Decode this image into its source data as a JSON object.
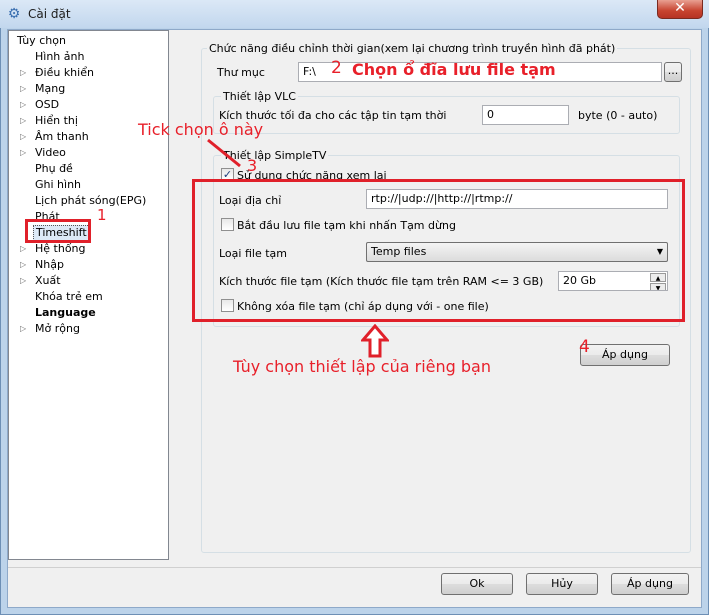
{
  "window": {
    "title": "Cài đặt",
    "close_glyph": "✕",
    "icon": "settings-app-icon"
  },
  "tree": {
    "root": "Tùy chọn",
    "items": [
      {
        "label": "Hình ảnh",
        "expander": false
      },
      {
        "label": "Điều khiển",
        "expander": true
      },
      {
        "label": "Mạng",
        "expander": true
      },
      {
        "label": "OSD",
        "expander": true
      },
      {
        "label": "Hiển thị",
        "expander": true
      },
      {
        "label": "Âm thanh",
        "expander": true
      },
      {
        "label": "Video",
        "expander": true
      },
      {
        "label": "Phụ đề",
        "expander": false
      },
      {
        "label": "Ghi hình",
        "expander": false
      },
      {
        "label": "Lịch phát sóng(EPG)",
        "expander": false
      },
      {
        "label": "Phát",
        "expander": false
      },
      {
        "label": "Timeshift",
        "expander": false,
        "selected": true
      },
      {
        "label": "Hệ thống",
        "expander": true
      },
      {
        "label": "Nhập",
        "expander": true
      },
      {
        "label": "Xuất",
        "expander": true
      },
      {
        "label": "Khóa trẻ em",
        "expander": false
      },
      {
        "label": "Language",
        "expander": false,
        "bold": true
      },
      {
        "label": "Mở rộng",
        "expander": true
      }
    ]
  },
  "timeshift": {
    "group_title": "Chức năng điều chỉnh thời gian(xem lại chương trình truyền hình đã phát)",
    "folder_label": "Thư mục",
    "folder_value": "F:\\",
    "browse_label": "...",
    "vlc_group": "Thiết lập VLC",
    "vlc_size_label": "Kích thước tối đa cho các tập tin tạm thời",
    "vlc_size_value": "0",
    "vlc_size_unit": "byte (0 - auto)",
    "simpletv_group": "Thiết lập SimpleTV",
    "use_replay_label": "Sử dụng chức năng xem lại",
    "use_replay_checked": true,
    "address_type_label": "Loại địa chỉ",
    "address_type_value": "rtp://|udp://|http://|rtmp://",
    "start_on_pause_label": "Bắt đầu lưu file tạm khi nhấn Tạm dừng",
    "start_on_pause_checked": false,
    "file_type_label": "Loại file tạm",
    "file_type_value": "Temp files",
    "file_size_label": "Kích thước file tạm (Kích thước file tạm trên RAM <= 3 GB)",
    "file_size_value": "20 Gb",
    "keep_file_label": "Không xóa file tạm (chỉ áp dụng với - one file)",
    "keep_file_checked": false,
    "apply_label": "Áp dụng"
  },
  "footer": {
    "ok": "Ok",
    "cancel": "Hủy",
    "apply": "Áp dụng"
  },
  "annotations": {
    "n1": "1",
    "n2": "2",
    "choose_drive": "Chọn ổ đĩa lưu file tạm",
    "tick_box": "Tick chọn ô này",
    "n3": "3",
    "n4": "4",
    "custom_options": "Tùy chọn thiết lập của riêng bạn"
  },
  "colors": {
    "annotation_red": "#e8202a",
    "titlebar": "#c2d7ee",
    "close_button": "#c7432f"
  }
}
